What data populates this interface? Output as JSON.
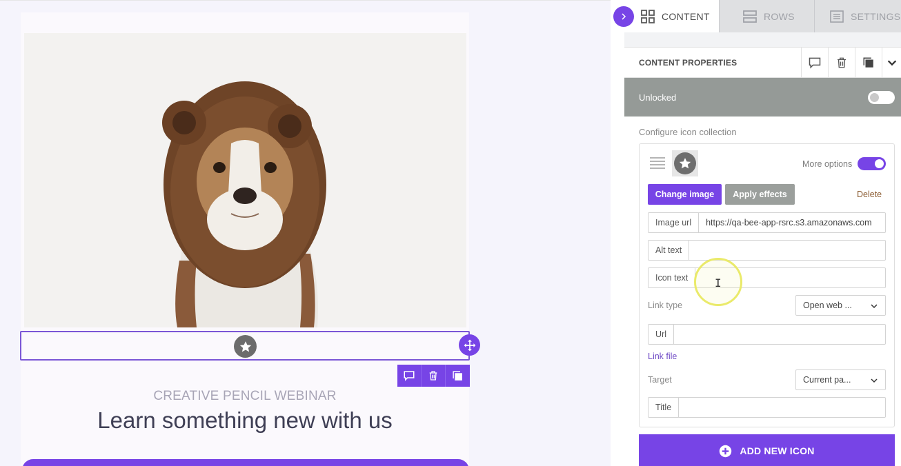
{
  "tabs": [
    {
      "label": "CONTENT",
      "icon": "grid-icon",
      "active": true
    },
    {
      "label": "ROWS",
      "icon": "rows-icon",
      "active": false
    },
    {
      "label": "SETTINGS",
      "icon": "settings-icon",
      "active": false
    }
  ],
  "preview": {
    "eyebrow": "CREATIVE PENCIL WEBINAR",
    "headline": "Learn something new with us"
  },
  "properties": {
    "title": "CONTENT PROPERTIES",
    "lock_label": "Unlocked",
    "locked": false,
    "configure_label": "Configure icon collection",
    "more_options_label": "More options",
    "more_options_on": true,
    "change_image": "Change image",
    "apply_effects": "Apply effects",
    "delete": "Delete",
    "image_url_label": "Image url",
    "image_url_value": "https://qa-bee-app-rsrc.s3.amazonaws.com",
    "alt_text_label": "Alt text",
    "alt_text_value": "",
    "icon_text_label": "Icon text",
    "icon_text_value": "",
    "link_type_label": "Link type",
    "link_type_value": "Open web ...",
    "url_label": "Url",
    "url_value": "",
    "link_file": "Link file",
    "target_label": "Target",
    "target_value": "Current pa...",
    "title_label": "Title",
    "title_value": "",
    "add_icon": "ADD NEW ICON"
  },
  "colors": {
    "accent": "#7744e6",
    "lock_bar": "#959a97",
    "secondary_button": "#9b9f9c"
  }
}
